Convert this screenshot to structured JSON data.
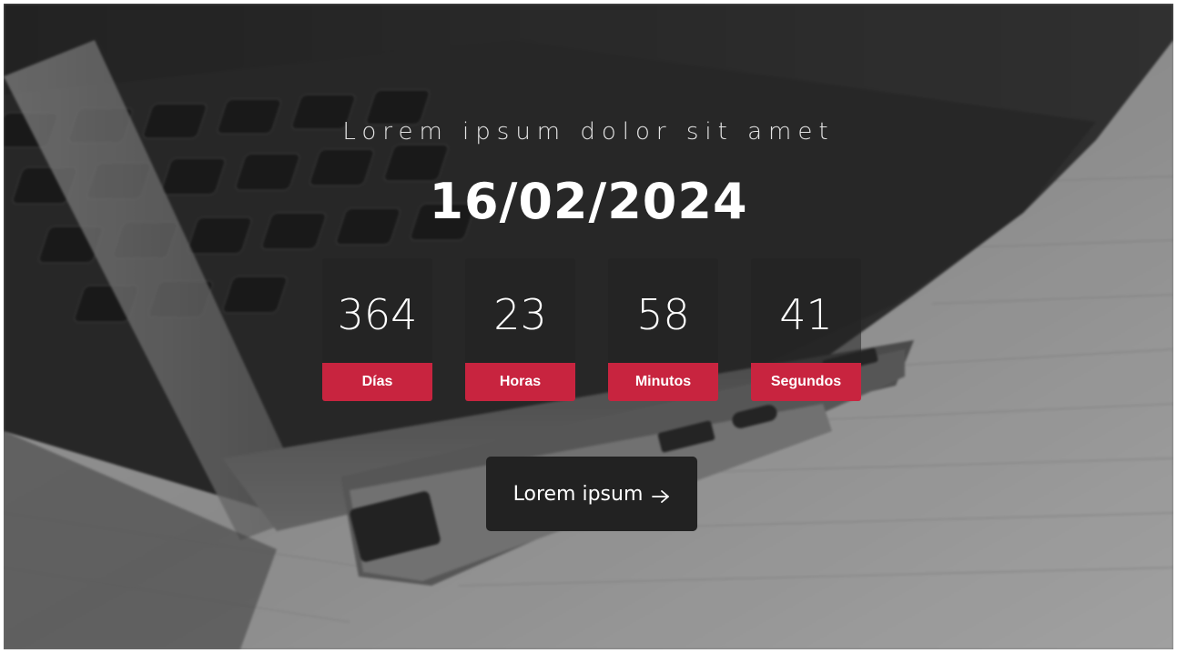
{
  "hero": {
    "subtitle": "Lorem ipsum dolor sit amet",
    "date": "16/02/2024"
  },
  "countdown": [
    {
      "value": "364",
      "label": "Días"
    },
    {
      "value": "23",
      "label": "Horas"
    },
    {
      "value": "58",
      "label": "Minutos"
    },
    {
      "value": "41",
      "label": "Segundos"
    }
  ],
  "cta": {
    "label": "Lorem ipsum",
    "icon": "arrow-right-icon"
  },
  "colors": {
    "accent": "#c8243f",
    "button_bg": "#222222",
    "text": "#ffffff"
  }
}
